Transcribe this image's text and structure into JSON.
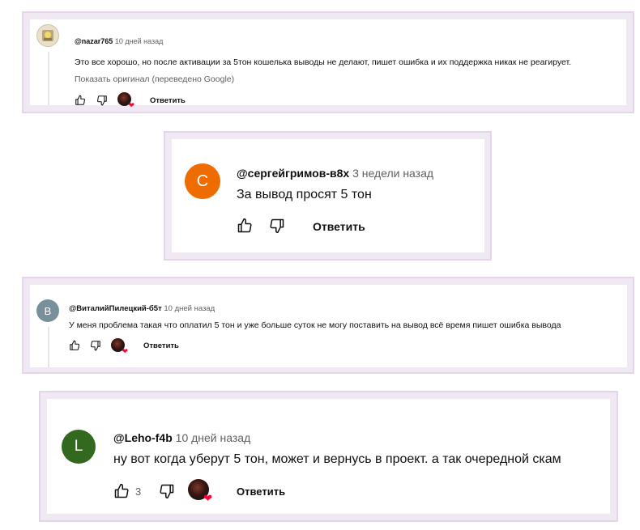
{
  "comments": [
    {
      "handle": "@nazar765",
      "time": "10 дней назад",
      "text": "Это все хорошо, но после активации за 5тон кошелька выводы не делают, пишет ошибка и их поддержка никак не реагирует.",
      "translate_link": "Показать оригинал (переведено Google)",
      "reply_label": "Ответить",
      "avatar_color": "#d9c9a8"
    },
    {
      "handle": "@сергейгримов-в8х",
      "time": "3 недели назад",
      "text": "За вывод просят 5 тон",
      "reply_label": "Ответить",
      "avatar_letter": "С",
      "avatar_color": "#ef6c00"
    },
    {
      "handle": "@ВиталийПилецкий-б5т",
      "time": "10 дней назад",
      "text": "У меня проблема такая что оплатил 5 тон и уже больше суток не могу поставить на вывод всё время пишет ошибка вывода",
      "reply_label": "Ответить",
      "avatar_letter": "В",
      "avatar_color": "#78909c"
    },
    {
      "handle": "@Leho-f4b",
      "time": "10 дней назад",
      "text": "ну вот когда уберут 5 тон, может и вернусь в проект. а так очередной скам",
      "likes": "3",
      "reply_label": "Ответить",
      "avatar_letter": "L",
      "avatar_color": "#33691e"
    }
  ],
  "icons": [
    "thumb-up-icon",
    "thumb-down-icon",
    "creator-heart-icon"
  ],
  "colors": {
    "card_border": "#e2d6e8",
    "secondary_text": "#606060",
    "heart": "#ff0033"
  }
}
